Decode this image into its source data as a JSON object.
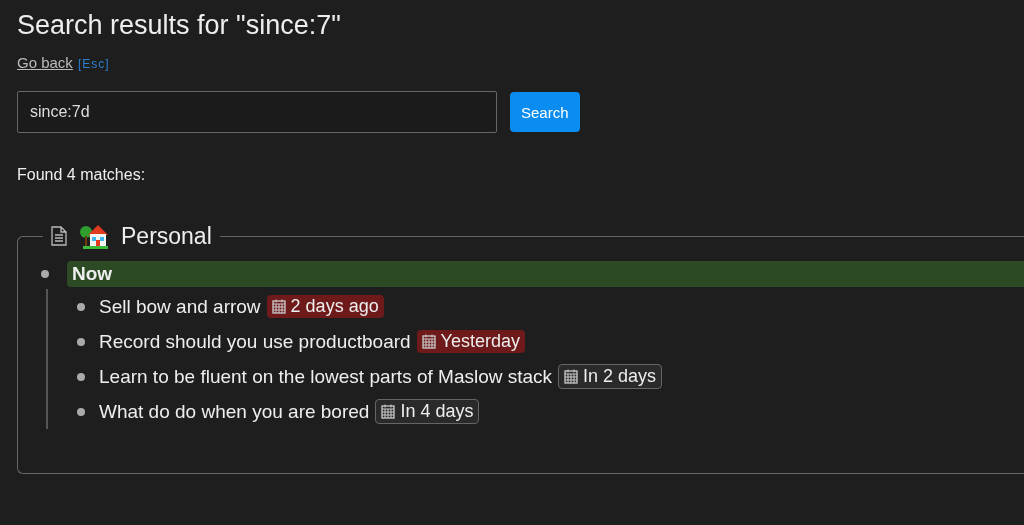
{
  "title": "Search results for \"since:7\"",
  "back": {
    "label": "Go back",
    "shortcut": "[Esc]"
  },
  "search": {
    "value": "since:7d",
    "button": "Search"
  },
  "summary": "Found 4 matches:",
  "group": {
    "title": "Personal",
    "heading": "Now",
    "items": [
      {
        "text": "Sell bow and arrow",
        "date": "2 days ago",
        "kind": "overdue"
      },
      {
        "text": "Record should you use productboard",
        "date": "Yesterday",
        "kind": "overdue"
      },
      {
        "text": "Learn to be fluent on the lowest parts of Maslow stack",
        "date": "In 2 days",
        "kind": "upcoming"
      },
      {
        "text": "What do do when you are bored",
        "date": "In 4 days",
        "kind": "upcoming"
      }
    ]
  }
}
